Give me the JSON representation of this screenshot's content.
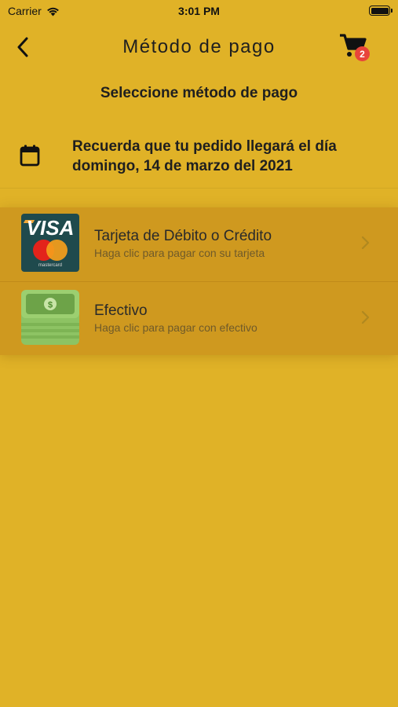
{
  "status_bar": {
    "carrier": "Carrier",
    "time": "3:01 PM"
  },
  "nav": {
    "title": "Método de pago",
    "cart_count": "2"
  },
  "section_title": "Seleccione método de pago",
  "delivery": {
    "message": "Recuerda que tu pedido llegará el día domingo, 14 de marzo del 2021"
  },
  "payment_methods": [
    {
      "name": "Tarjeta de Débito o Crédito",
      "description": "Haga clic para pagar con su tarjeta",
      "icon": "visa-mastercard-card-icon",
      "card_logo_text": "VISA",
      "card_brand_text": "mastercard"
    },
    {
      "name": "Efectivo",
      "description": "Haga clic para pagar con efectivo",
      "icon": "cash-bills-icon",
      "bill_symbol": "$"
    }
  ],
  "colors": {
    "background": "#e0b227",
    "list_item": "#cf991f",
    "badge": "#e8443a",
    "cash_green": "#8dc363"
  }
}
